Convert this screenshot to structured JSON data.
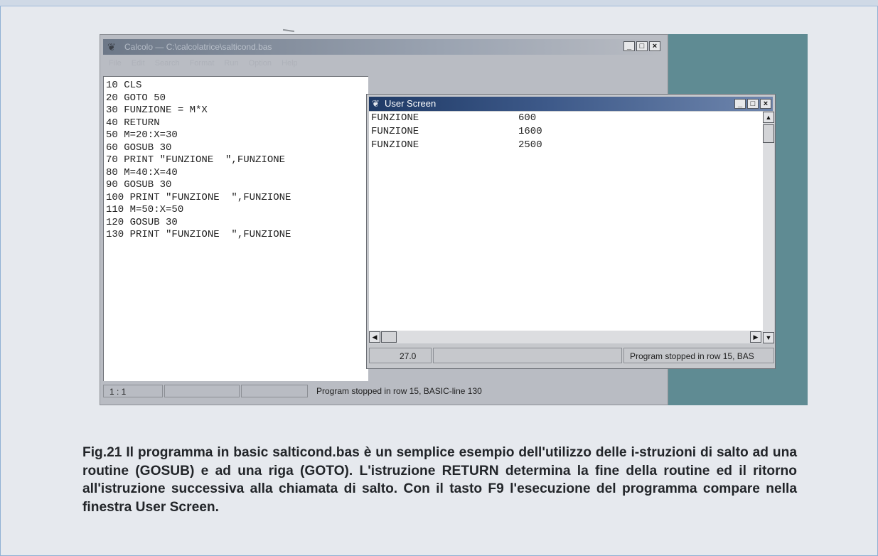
{
  "main_window": {
    "title": "Calcolo — C:\\calcolatrice\\salticond.bas",
    "menu": [
      "File",
      "Edit",
      "Search",
      "Format",
      "Run",
      "Option",
      "Help"
    ],
    "code_lines": [
      "10 CLS",
      "20 GOTO 50",
      "30 FUNZIONE = M*X",
      "40 RETURN",
      "50 M=20:X=30",
      "60 GOSUB 30",
      "70 PRINT \"FUNZIONE  \",FUNZIONE",
      "80 M=40:X=40",
      "90 GOSUB 30",
      "100 PRINT \"FUNZIONE  \",FUNZIONE",
      "110 M=50:X=50",
      "120 GOSUB 30",
      "130 PRINT \"FUNZIONE  \",FUNZIONE"
    ],
    "status": {
      "position": "1 : 1",
      "message": "Program stopped in row 15,  BASIC-line 130"
    }
  },
  "user_screen": {
    "title": "User Screen",
    "output": [
      {
        "label": "FUNZIONE",
        "value": "600"
      },
      {
        "label": "FUNZIONE",
        "value": "1600"
      },
      {
        "label": "FUNZIONE",
        "value": "2500"
      }
    ],
    "status": {
      "left": "27.0",
      "message": "Program stopped in row 15,  BAS"
    }
  },
  "window_buttons": {
    "minimize": "_",
    "maximize": "□",
    "close": "×"
  },
  "scroll_glyphs": {
    "up": "▲",
    "down": "▼",
    "left": "◀",
    "right": "▶"
  },
  "icons": {
    "app": "app-icon"
  },
  "caption": "Fig.21 Il programma in basic salticond.bas è un semplice esempio dell'utilizzo delle i-struzioni di salto ad una routine (GOSUB) e ad una riga (GOTO). L'istruzione RETURN determina la fine della routine ed il ritorno all'istruzione successiva alla chiamata di salto. Con il tasto F9 l'esecuzione del programma compare nella finestra User Screen."
}
